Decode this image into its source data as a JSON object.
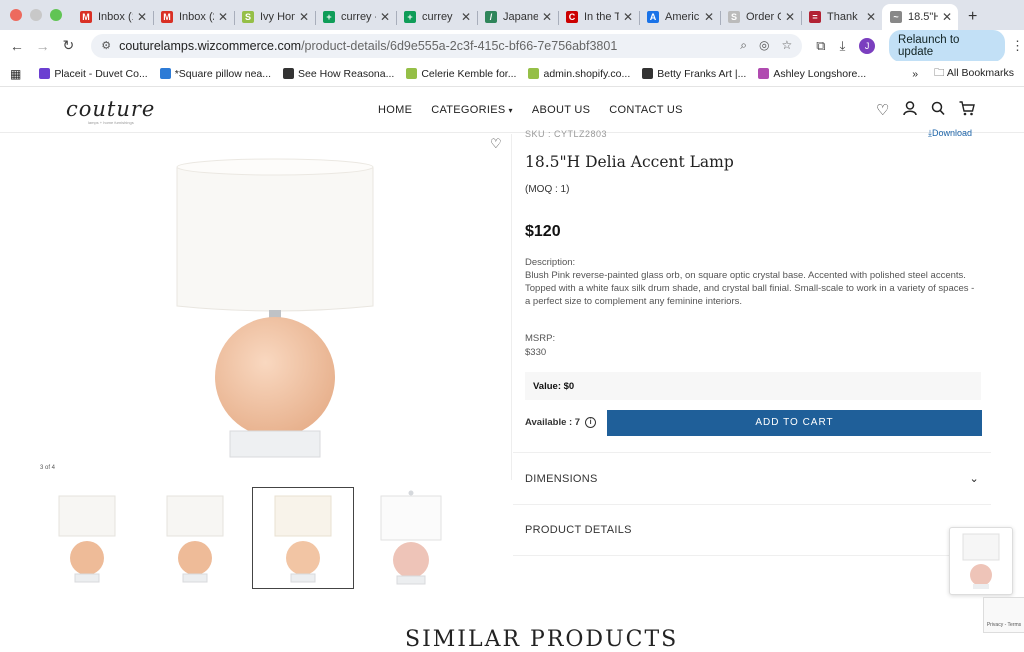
{
  "browser": {
    "tabs": [
      {
        "title": "Inbox (1",
        "fav_color": "#d93025",
        "fav_letter": "M"
      },
      {
        "title": "Inbox (2",
        "fav_color": "#d93025",
        "fav_letter": "M"
      },
      {
        "title": "Ivy Hom",
        "fav_color": "#95bf47",
        "fav_letter": "S"
      },
      {
        "title": "currey -",
        "fav_color": "#0f9d58",
        "fav_letter": "+"
      },
      {
        "title": "currey",
        "fav_color": "#0f9d58",
        "fav_letter": "+"
      },
      {
        "title": "Japanes",
        "fav_color": "#2f855a",
        "fav_letter": "/"
      },
      {
        "title": "In the T",
        "fav_color": "#cc0000",
        "fav_letter": "C"
      },
      {
        "title": "Americ",
        "fav_color": "#1a73e8",
        "fav_letter": "A"
      },
      {
        "title": "Order C",
        "fav_color": "#bbbbbb",
        "fav_letter": "S"
      },
      {
        "title": "Thank",
        "fav_color": "#b22234",
        "fav_letter": "="
      },
      {
        "title": "18.5\"H",
        "fav_color": "#888888",
        "fav_letter": "~",
        "active": true
      }
    ],
    "url_host": "couturelamps.wizcommerce.com",
    "url_path": "/product-details/6d9e555a-2c3f-415c-bf66-7e756abf3801",
    "avatar_letter": "J",
    "relaunch_label": "Relaunch to update",
    "bookmarks": [
      {
        "label": "Placeit - Duvet Co...",
        "color": "#6b3fd1"
      },
      {
        "label": "*Square pillow nea...",
        "color": "#2d7bd6"
      },
      {
        "label": "See How Reasona...",
        "color": "#333333"
      },
      {
        "label": "Celerie Kemble for...",
        "color": "#95bf47"
      },
      {
        "label": "admin.shopify.co...",
        "color": "#95bf47"
      },
      {
        "label": "Betty Franks Art |...",
        "color": "#333333"
      },
      {
        "label": "Ashley Longshore...",
        "color": "#b04bb0"
      }
    ],
    "more_label": "»",
    "all_bookmarks_label": "All Bookmarks"
  },
  "site": {
    "logo": "couture",
    "logo_sub": "lamps + home furnishings",
    "nav": [
      "HOME",
      "CATEGORIES",
      "ABOUT US",
      "CONTACT US"
    ]
  },
  "product": {
    "sku": "SKU : CYTLZ2803",
    "download_label": "Download",
    "title": "18.5\"H Delia Accent Lamp",
    "moq": "(MOQ : 1)",
    "price": "$120",
    "description_label": "Description:",
    "description": "Blush Pink reverse-painted glass orb, on square optic crystal base. Accented with polished steel accents. Topped with a white faux silk drum shade, and crystal ball finial. Small-scale to work in a variety of spaces - a perfect size to complement any feminine interiors.",
    "msrp_label": "MSRP:",
    "msrp": "$330",
    "value_label": "Value: $0",
    "available": "Available : 7",
    "add_to_cart": "ADD TO CART",
    "image_counter": "3 of 4",
    "accordions": [
      "DIMENSIONS",
      "PRODUCT DETAILS"
    ]
  },
  "similar_heading": "SIMILAR PRODUCTS",
  "recaptcha_text": "Privacy - Terms",
  "colors": {
    "accent": "#1f5f99",
    "lamp_base": "#f2c5a4",
    "shade": "#f8f6f2"
  }
}
